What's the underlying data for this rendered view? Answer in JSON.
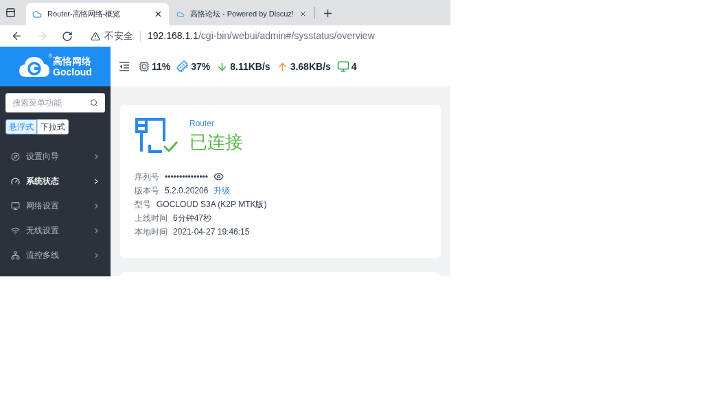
{
  "browser": {
    "tabs": [
      {
        "title": "Router-高恪网络-概览",
        "selected": true
      },
      {
        "title": "高恪论坛 - Powered by Discuz!",
        "selected": false
      }
    ],
    "security": "不安全",
    "url_host": "192.168.1.1",
    "url_path": "/cgi-bin/webui/admin#/sysstatus/overview"
  },
  "logo": {
    "name": "高恪网络",
    "brand": "Gocloud",
    "mark": "®"
  },
  "stats": [
    {
      "kind": "cpu",
      "value": "11%"
    },
    {
      "kind": "memory",
      "value": "37%"
    },
    {
      "kind": "download",
      "value": "8.11KB/s"
    },
    {
      "kind": "upload",
      "value": "3.68KB/s"
    },
    {
      "kind": "devices",
      "value": "4"
    }
  ],
  "sidebar": {
    "search": {
      "placeholder": "搜索菜单功能"
    },
    "modes": [
      {
        "label": "悬浮式",
        "selected": true
      },
      {
        "label": "下拉式",
        "selected": false
      }
    ],
    "items": [
      {
        "kind": "wizard",
        "label": "设置向导",
        "selected": false
      },
      {
        "kind": "status",
        "label": "系统状态",
        "selected": true
      },
      {
        "kind": "network",
        "label": "网络设置",
        "selected": false
      },
      {
        "kind": "wireless",
        "label": "无线设置",
        "selected": false
      },
      {
        "kind": "multiline",
        "label": "流控多线",
        "selected": false
      }
    ]
  },
  "status_card": {
    "device": "Router",
    "state": "已连接",
    "rows": [
      {
        "kind": "masked",
        "label": "序列号",
        "value": "•••••••••••••••"
      },
      {
        "kind": "text",
        "label": "版本号",
        "value": "5.2.0.20206",
        "link": "升级"
      },
      {
        "kind": "text",
        "label": "型号",
        "value": "GOCLOUD S3A (K2P MTK版)"
      },
      {
        "kind": "text",
        "label": "上线时间",
        "value": "6分钟47秒"
      },
      {
        "kind": "text",
        "label": "本地时间",
        "value": "2021-04-27 19:46:15"
      }
    ]
  }
}
